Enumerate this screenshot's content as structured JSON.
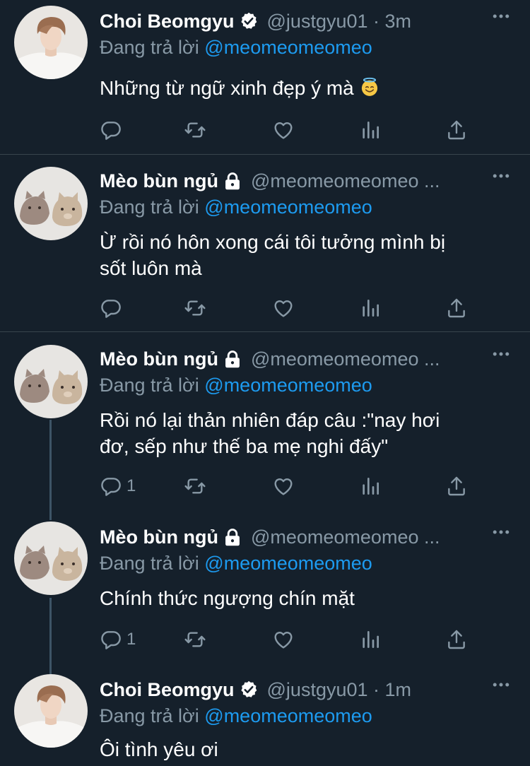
{
  "reply_prefix": "Đang trả lời",
  "tweets": [
    {
      "name": "Choi Beomgyu",
      "badge": "verified-badge",
      "handle": "@justgyu01 · 3m",
      "reply_to": "@meomeomeomeo",
      "text": "Những từ ngữ xinh đẹp ý mà",
      "emoji": "halo-smile-emoji",
      "reply_count": ""
    },
    {
      "name": "Mèo bùn ngủ",
      "badge": "lock-badge",
      "handle": "@meomeomeomeo ...",
      "reply_to": "@meomeomeomeo",
      "text_line1": "Ừ rồi nó hôn xong cái tôi tưởng mình bị",
      "text_line2": "sốt luôn mà",
      "reply_count": ""
    },
    {
      "name": "Mèo bùn ngủ",
      "badge": "lock-badge",
      "handle": "@meomeomeomeo ...",
      "reply_to": "@meomeomeomeo",
      "text_line1": "Rồi nó lại thản nhiên đáp câu :\"nay hơi",
      "text_line2": "đơ, sếp như thế ba mẹ nghi đấy\"",
      "reply_count": "1"
    },
    {
      "name": "Mèo bùn ngủ",
      "badge": "lock-badge",
      "handle": "@meomeomeomeo ...",
      "reply_to": "@meomeomeomeo",
      "text": "Chính thức ngượng chín mặt",
      "reply_count": "1"
    },
    {
      "name": "Choi Beomgyu",
      "badge": "verified-badge",
      "handle": "@justgyu01 · 1m",
      "reply_to": "@meomeomeomeo",
      "text": "Ôi tình yêu ơi"
    }
  ],
  "colors": {
    "background": "#15202b",
    "separator": "#38444d",
    "muted": "#8899a6",
    "accent": "#1d9bf0"
  },
  "icons": [
    "reply-icon",
    "retweet-icon",
    "like-icon",
    "analytics-icon",
    "share-icon",
    "more-icon"
  ]
}
